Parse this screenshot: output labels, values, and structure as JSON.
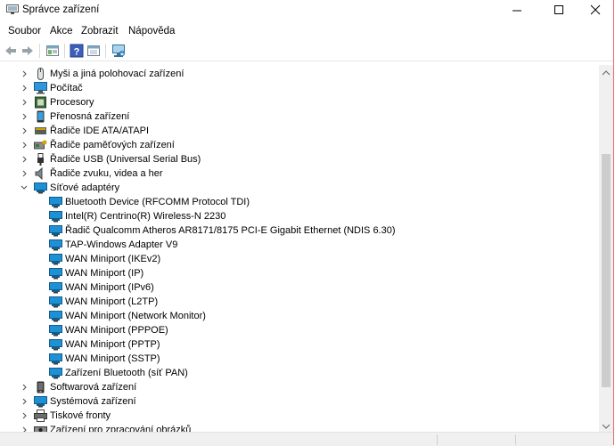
{
  "window": {
    "title": "Správce zařízení"
  },
  "menu": {
    "items": [
      "Soubor",
      "Akce",
      "Zobrazit",
      "Nápověda"
    ]
  },
  "toolbar": {
    "buttons": [
      "back-arrow",
      "forward-arrow",
      "properties",
      "help",
      "refresh",
      "scan-hardware"
    ]
  },
  "tree": {
    "items": [
      {
        "label": "Myši a jiná polohovací zařízení",
        "icon": "mouse-icon",
        "expanded": false
      },
      {
        "label": "Počítač",
        "icon": "computer-icon",
        "expanded": false
      },
      {
        "label": "Procesory",
        "icon": "processor-icon",
        "expanded": false
      },
      {
        "label": "Přenosná zařízení",
        "icon": "portable-device-icon",
        "expanded": false
      },
      {
        "label": "Řadiče IDE ATA/ATAPI",
        "icon": "ide-controller-icon",
        "expanded": false
      },
      {
        "label": "Řadiče paměťových zařízení",
        "icon": "storage-controller-icon",
        "expanded": false
      },
      {
        "label": "Řadiče USB (Universal Serial Bus)",
        "icon": "usb-icon",
        "expanded": false
      },
      {
        "label": "Řadiče zvuku, videa a her",
        "icon": "speaker-icon",
        "expanded": false
      },
      {
        "label": "Síťové adaptéry",
        "icon": "network-adapter-icon",
        "expanded": true,
        "children": [
          "Bluetooth Device (RFCOMM Protocol TDI)",
          "Intel(R) Centrino(R) Wireless-N 2230",
          "Řadič Qualcomm Atheros AR8171/8175 PCI-E Gigabit Ethernet (NDIS 6.30)",
          "TAP-Windows Adapter V9",
          "WAN Miniport (IKEv2)",
          "WAN Miniport (IP)",
          "WAN Miniport (IPv6)",
          "WAN Miniport (L2TP)",
          "WAN Miniport (Network Monitor)",
          "WAN Miniport (PPPOE)",
          "WAN Miniport (PPTP)",
          "WAN Miniport (SSTP)",
          "Zařízení Bluetooth (síť PAN)"
        ]
      },
      {
        "label": "Softwarová zařízení",
        "icon": "software-device-icon",
        "expanded": false
      },
      {
        "label": "Systémová zařízení",
        "icon": "system-device-icon",
        "expanded": false
      },
      {
        "label": "Tiskové fronty",
        "icon": "printer-icon",
        "expanded": false
      },
      {
        "label": "Zařízení pro zpracování obrázků",
        "icon": "imaging-device-icon",
        "expanded": false
      }
    ]
  },
  "colors": {
    "net_icon": "#1e90d6",
    "chevron": "#555555"
  }
}
